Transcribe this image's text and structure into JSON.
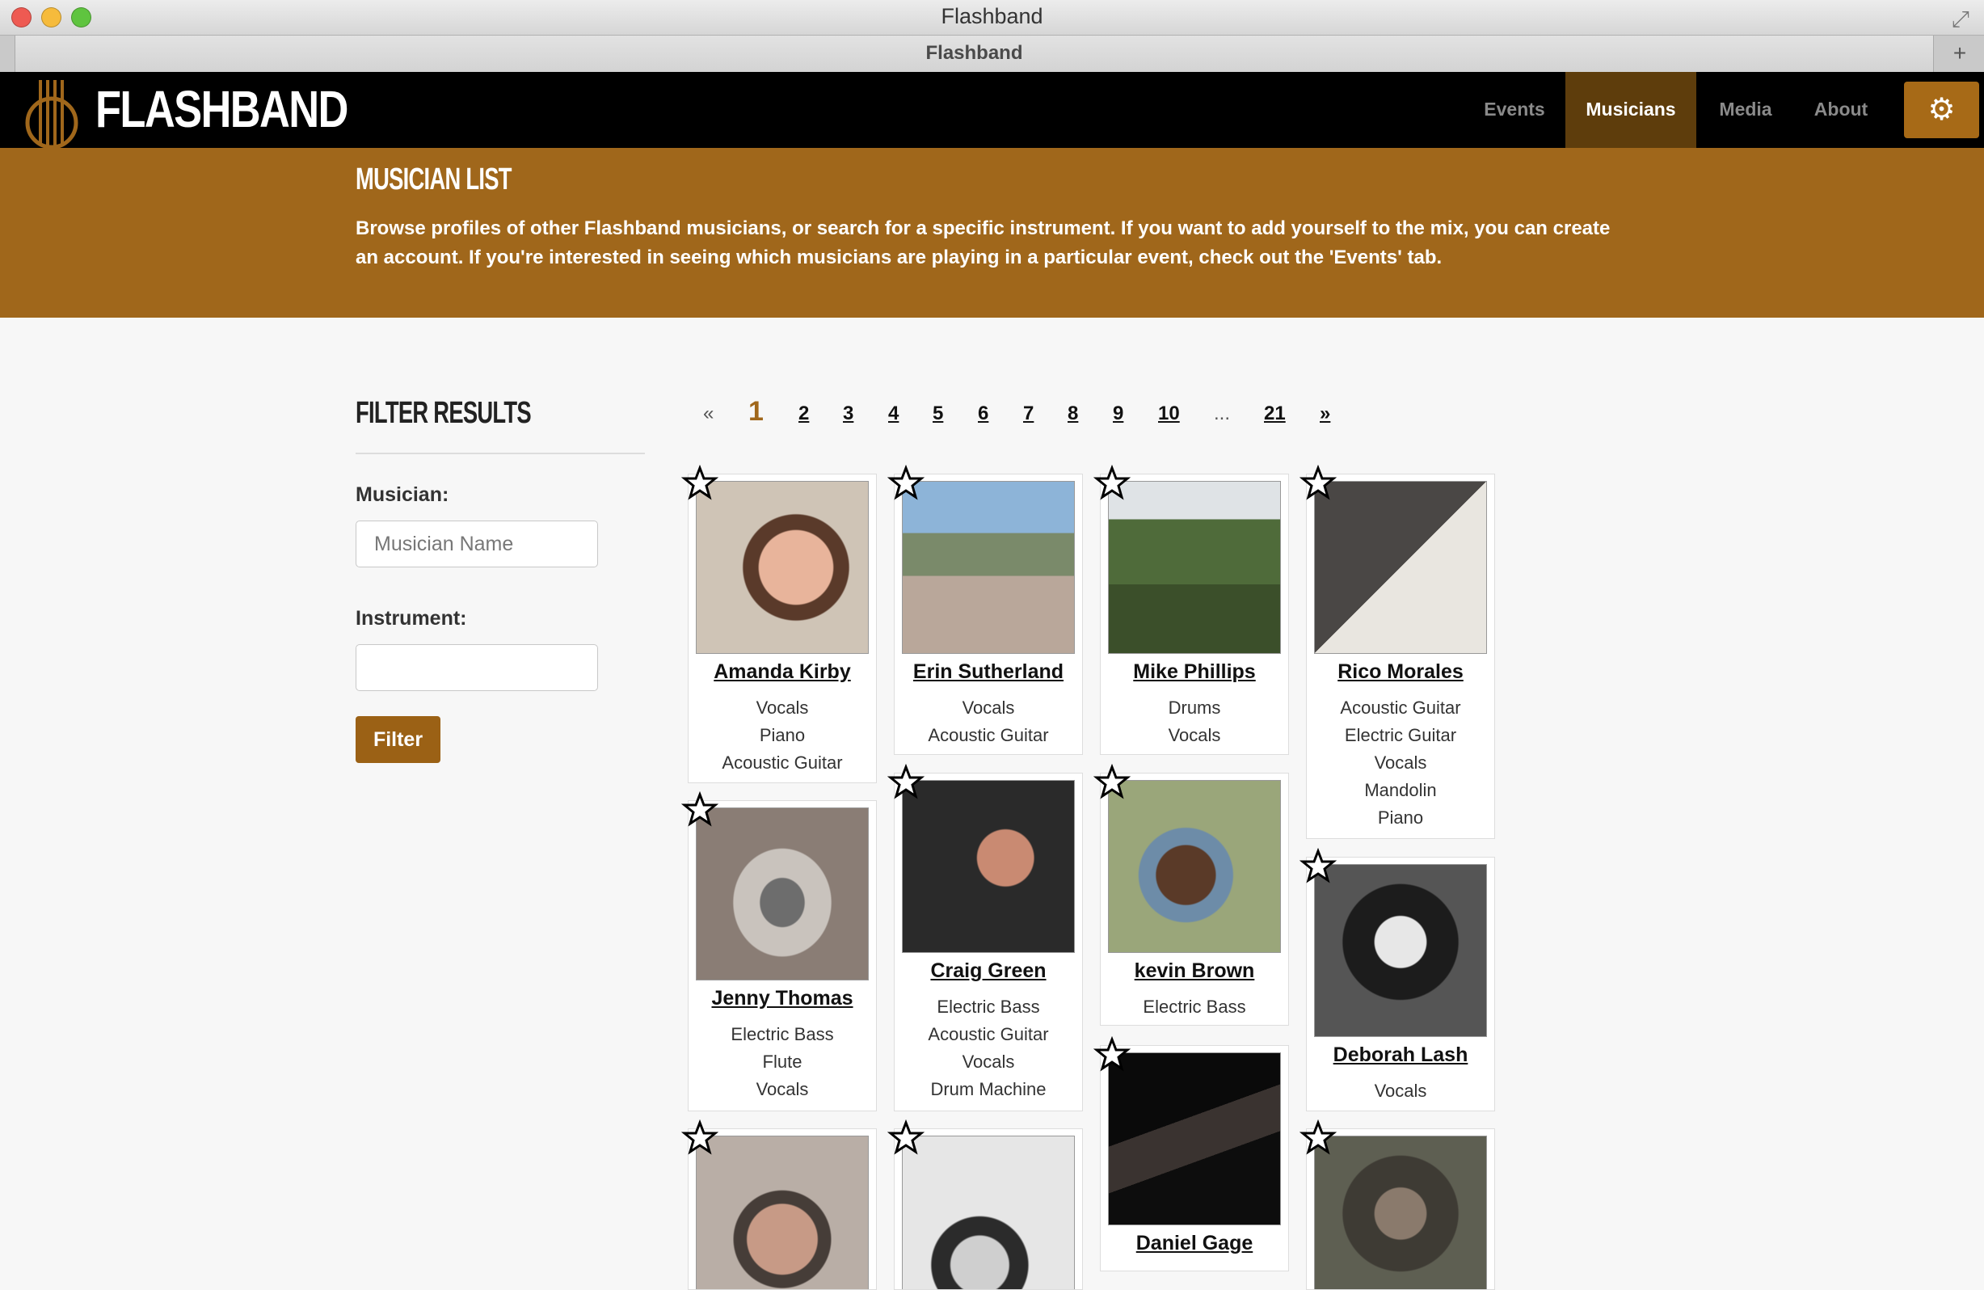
{
  "window": {
    "title": "Flashband",
    "tab_title": "Flashband"
  },
  "nav": {
    "brand": "FLASHBAND",
    "links": [
      "Events",
      "Musicians",
      "Media",
      "About"
    ],
    "active": "Musicians"
  },
  "banner": {
    "title": "MUSICIAN LIST",
    "text": "Browse profiles of other Flashband musicians, or search for a specific instrument. If you want to add yourself to the mix, you can create an account. If you're interested in seeing which musicians are playing in a particular event, check out the 'Events' tab."
  },
  "filter": {
    "title": "FILTER RESULTS",
    "musician_label": "Musician:",
    "musician_placeholder": "Musician Name",
    "musician_value": "",
    "instrument_label": "Instrument:",
    "instrument_value": "",
    "button": "Filter"
  },
  "pagination": {
    "prev": "«",
    "pages": [
      "1",
      "2",
      "3",
      "4",
      "5",
      "6",
      "7",
      "8",
      "9",
      "10",
      "...",
      "21"
    ],
    "current": "1",
    "next": "»"
  },
  "musicians": [
    {
      "name": "Amanda Kirby",
      "instruments": [
        "Vocals",
        "Piano",
        "Acoustic Guitar"
      ]
    },
    {
      "name": "Erin Sutherland",
      "instruments": [
        "Vocals",
        "Acoustic Guitar"
      ]
    },
    {
      "name": "Mike Phillips",
      "instruments": [
        "Drums",
        "Vocals"
      ]
    },
    {
      "name": "Rico Morales",
      "instruments": [
        "Acoustic Guitar",
        "Electric Guitar",
        "Vocals",
        "Mandolin",
        "Piano"
      ]
    },
    {
      "name": "Jenny Thomas",
      "instruments": [
        "Electric Bass",
        "Flute",
        "Vocals"
      ]
    },
    {
      "name": "Craig Green",
      "instruments": [
        "Electric Bass",
        "Acoustic Guitar",
        "Vocals",
        "Drum Machine"
      ]
    },
    {
      "name": "kevin Brown",
      "instruments": [
        "Electric Bass"
      ]
    },
    {
      "name": "Deborah Lash",
      "instruments": [
        "Vocals"
      ]
    },
    {
      "name": "Daniel Gage",
      "instruments": []
    },
    {
      "name": "",
      "instruments": []
    },
    {
      "name": "",
      "instruments": []
    },
    {
      "name": "",
      "instruments": []
    }
  ],
  "colors": {
    "brand": "#a0671b",
    "nav_active": "#5e3d0c",
    "navbar": "#000000"
  }
}
